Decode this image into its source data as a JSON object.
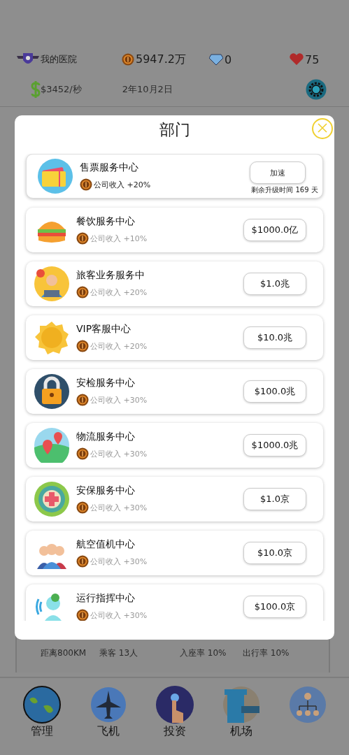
{
  "header": {
    "hospital": "我的医院",
    "coins": "5947.2万",
    "gems": "0",
    "hearts": "75",
    "income": "$3452/秒",
    "date": "2年10月2日"
  },
  "dialog": {
    "title": "部门",
    "departments": [
      {
        "name": "售票服务中心",
        "bonus": "公司收入 +20%",
        "kind": "upgrading",
        "action": "加速",
        "note": "剩余升级时间 169 天"
      },
      {
        "name": "餐饮服务中心",
        "bonus": "公司收入 +10%",
        "kind": "locked",
        "action": "$1000.0亿"
      },
      {
        "name": "旅客业务服务中",
        "bonus": "公司收入 +20%",
        "kind": "locked",
        "action": "$1.0兆"
      },
      {
        "name": "VIP客服中心",
        "bonus": "公司收入 +20%",
        "kind": "locked",
        "action": "$10.0兆"
      },
      {
        "name": "安检服务中心",
        "bonus": "公司收入 +30%",
        "kind": "locked",
        "action": "$100.0兆"
      },
      {
        "name": "物流服务中心",
        "bonus": "公司收入 +30%",
        "kind": "locked",
        "action": "$1000.0兆"
      },
      {
        "name": "安保服务中心",
        "bonus": "公司收入 +30%",
        "kind": "locked",
        "action": "$1.0京"
      },
      {
        "name": "航空值机中心",
        "bonus": "公司收入 +30%",
        "kind": "locked",
        "action": "$10.0京"
      },
      {
        "name": "运行指挥中心",
        "bonus": "公司收入 +30%",
        "kind": "locked",
        "action": "$100.0京"
      }
    ]
  },
  "stats": [
    "距离800KM",
    "乘客 13人",
    "入座率 10%",
    "出行率 10%"
  ],
  "nav": [
    "管理",
    "飞机",
    "投资",
    "机场"
  ]
}
